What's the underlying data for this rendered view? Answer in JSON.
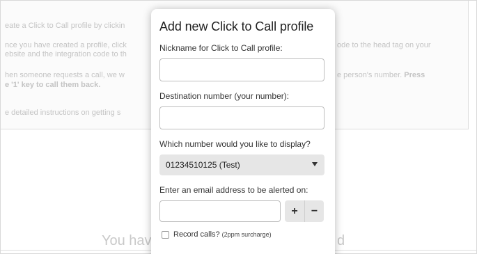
{
  "background": {
    "left_lines": [
      "eate a Click to Call profile by clickin",
      "nce you have created a profile, click",
      "ebsite and the integration code to th",
      "hen someone requests a call, we w",
      "e '1' key to call them back.",
      "e detailed instructions on getting s"
    ],
    "right_lines": {
      "line1": "ode to the head tag on your",
      "line2": "e person's number.",
      "line2_bold": "Press"
    },
    "empty_state_left": "You hav",
    "empty_state_right": "d"
  },
  "modal": {
    "title": "Add new Click to Call profile",
    "nickname_label": "Nickname for Click to Call profile:",
    "nickname_value": "",
    "destination_label": "Destination number (your number):",
    "destination_value": "",
    "display_label": "Which number would you like to display?",
    "display_selected": "01234510125 (Test)",
    "email_label": "Enter an email address to be alerted on:",
    "email_value": "",
    "add_button": "+",
    "remove_button": "−",
    "record_label": "Record calls?",
    "record_note": "(2ppm surcharge)",
    "record_checked": false
  }
}
